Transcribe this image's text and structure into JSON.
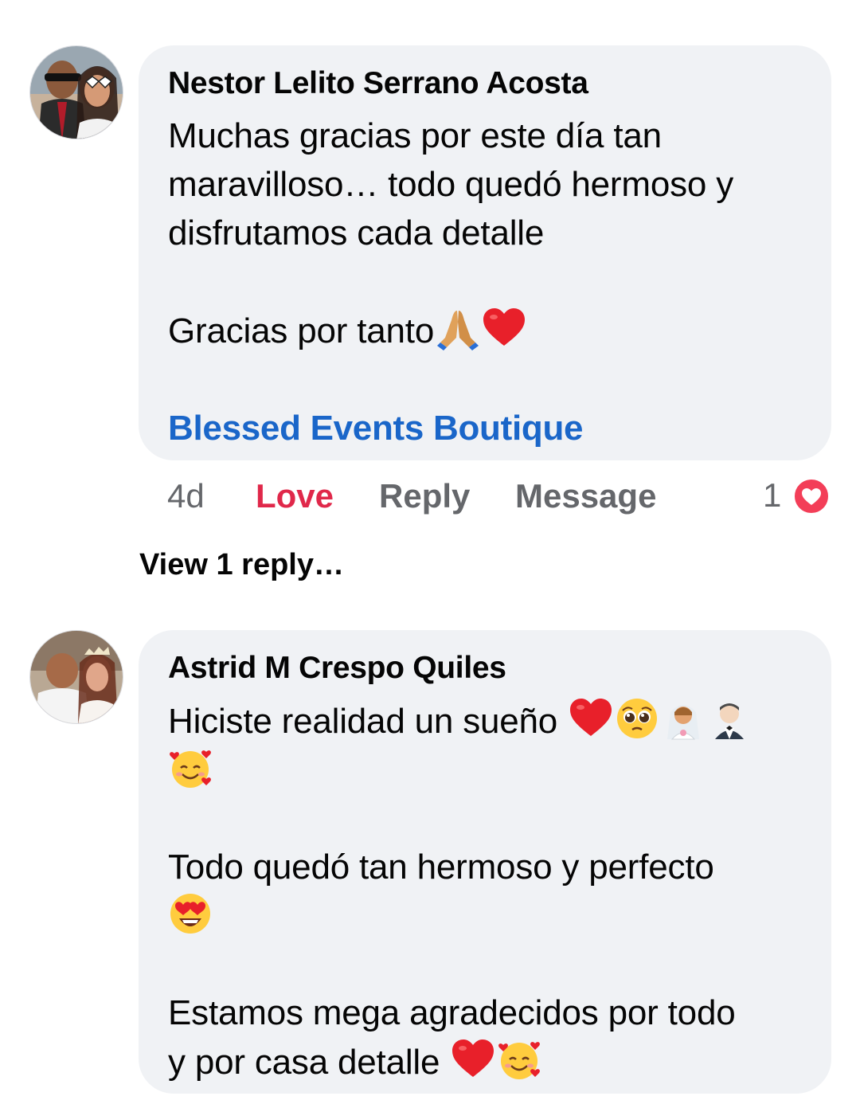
{
  "comments": [
    {
      "author": "Nestor Lelito Serrano Acosta",
      "lines": [
        "Muchas gracias por este día tan",
        "maravilloso… todo quedó hermoso y",
        "disfrutamos cada detalle",
        "",
        "Gracias por tanto"
      ],
      "mention": "Blessed Events Boutique",
      "time": "4d",
      "reaction_label": "Love",
      "reply_label": "Reply",
      "message_label": "Message",
      "reaction_count": "1",
      "view_replies": "View 1 reply…"
    },
    {
      "author": "Astrid M Crespo Quiles",
      "line1": "Hiciste realidad un sueño",
      "line2": "Todo quedó tan hermoso y perfecto",
      "line3": "Estamos mega agradecidos por todo",
      "line4": "y por casa detalle"
    }
  ],
  "colors": {
    "bubble": "#f0f2f5",
    "link": "#1a66c9",
    "love": "#e0284a",
    "secondary_text": "#65676b"
  }
}
